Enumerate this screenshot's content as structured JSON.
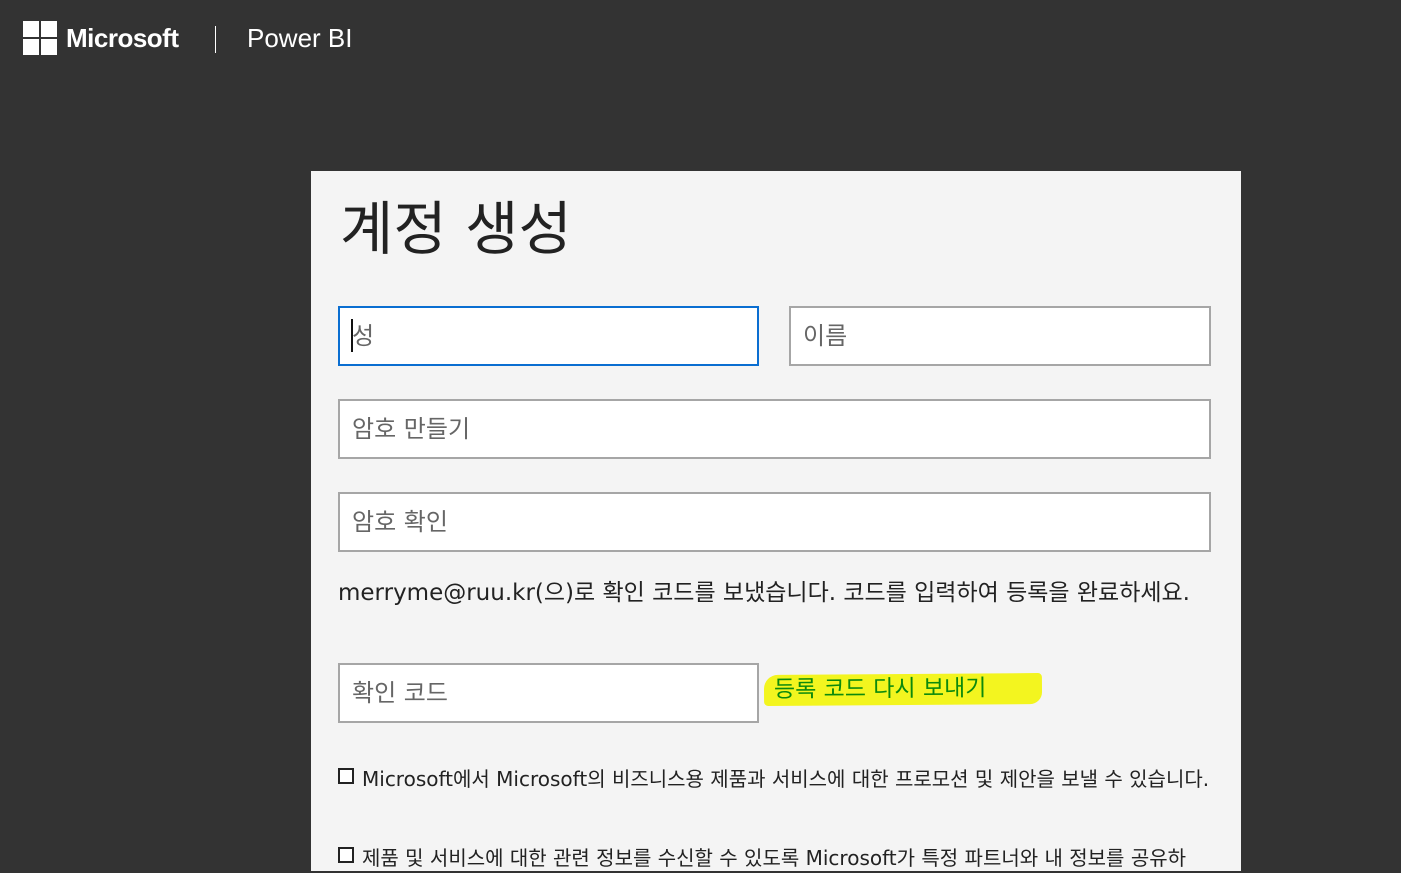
{
  "header": {
    "brand": "Microsoft",
    "product": "Power BI"
  },
  "form": {
    "title": "계정 생성",
    "fields": {
      "last_name_placeholder": "성",
      "first_name_placeholder": "이름",
      "password_placeholder": "암호 만들기",
      "confirm_password_placeholder": "암호 확인",
      "code_placeholder": "확인 코드"
    },
    "info_text": "merryme@ruu.kr(으)로 확인 코드를 보냈습니다. 코드를 입력하여 등록을 완료하세요.",
    "resend_label": "등록 코드 다시 보내기",
    "checkboxes": [
      {
        "label": "Microsoft에서 Microsoft의 비즈니스용 제품과 서비스에 대한 프로모션 및 제안을 보낼 수 있습니다."
      },
      {
        "label": "제품 및 서비스에 대한 관련 정보를 수신할 수 있도록 Microsoft가 특정 파트너와 내 정보를 공유하"
      }
    ]
  },
  "colors": {
    "background": "#333333",
    "card": "#f4f4f4",
    "focus_border": "#0a6ed1",
    "highlight": "#f3f51f",
    "link": "#0c8a0c"
  }
}
